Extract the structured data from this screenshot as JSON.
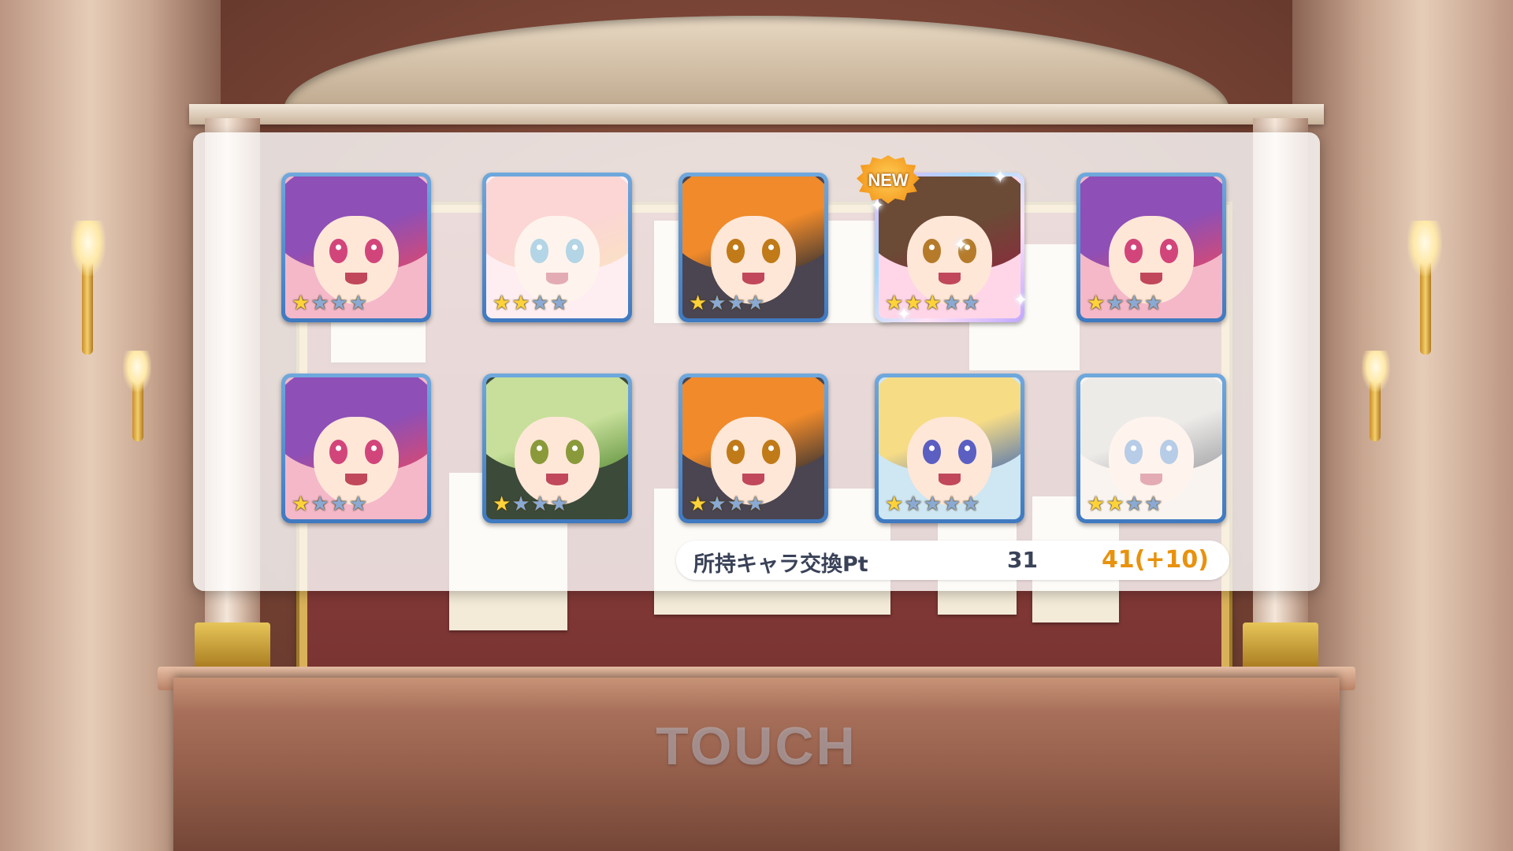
{
  "screen": "gacha-result",
  "badge": {
    "new_label": "NEW"
  },
  "results": [
    {
      "stars": 1,
      "max_stars": 4,
      "hair": "#8e4fb6",
      "accent": "#e0496a",
      "eye": "#d2457a",
      "bg": "#f4b8c9",
      "faded": false,
      "new": false
    },
    {
      "stars": 2,
      "max_stars": 4,
      "hair": "#f6a4a0",
      "accent": "#f6c07a",
      "eye": "#57a3c8",
      "bg": "#ffd9e0",
      "faded": true,
      "new": false
    },
    {
      "stars": 1,
      "max_stars": 4,
      "hair": "#f08a2a",
      "accent": "#2d2d33",
      "eye": "#c07a18",
      "bg": "#4a4550",
      "faded": false,
      "new": false
    },
    {
      "stars": 3,
      "max_stars": 5,
      "hair": "#6b4a36",
      "accent": "#8b2b3c",
      "eye": "#b57b2b",
      "bg": "#ffd6e8",
      "faded": false,
      "new": true
    },
    {
      "stars": 1,
      "max_stars": 4,
      "hair": "#8e4fb6",
      "accent": "#e0496a",
      "eye": "#d2457a",
      "bg": "#f4b8c9",
      "faded": false,
      "new": false
    },
    {
      "stars": 1,
      "max_stars": 4,
      "hair": "#8e4fb6",
      "accent": "#e0496a",
      "eye": "#d2457a",
      "bg": "#f4b8c9",
      "faded": false,
      "new": false
    },
    {
      "stars": 1,
      "max_stars": 4,
      "hair": "#c7df9a",
      "accent": "#5c8f3a",
      "eye": "#8a9a3a",
      "bg": "#3c4a3a",
      "faded": false,
      "new": false
    },
    {
      "stars": 1,
      "max_stars": 4,
      "hair": "#f08a2a",
      "accent": "#2d2d33",
      "eye": "#c07a18",
      "bg": "#4a4550",
      "faded": false,
      "new": false
    },
    {
      "stars": 1,
      "max_stars": 5,
      "hair": "#f7dc86",
      "accent": "#4a6fb0",
      "eye": "#5b5fc2",
      "bg": "#cfe6f3",
      "faded": false,
      "new": false
    },
    {
      "stars": 2,
      "max_stars": 4,
      "hair": "#d7d2cc",
      "accent": "#2e2e36",
      "eye": "#5f8fc7",
      "bg": "#f2e6dd",
      "faded": true,
      "new": false
    }
  ],
  "points": {
    "label": "所持キャラ交換Pt",
    "current": "31",
    "after": "41(+10)"
  },
  "prompt": "TOUCH",
  "colors": {
    "star_on": "#ffd23a",
    "star_off": "#8aa9d3",
    "points_after": "#e8920e",
    "frame": "#3f79c0"
  }
}
